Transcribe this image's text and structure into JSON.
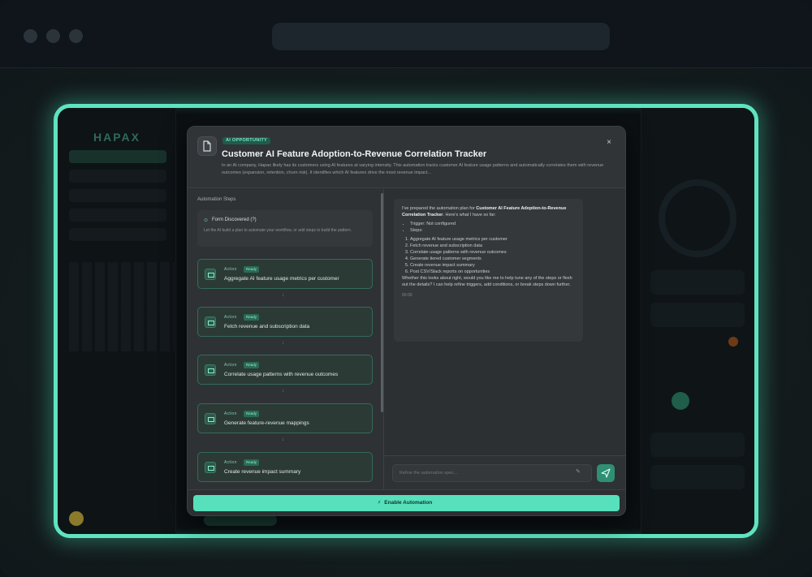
{
  "modal": {
    "badge": "AI Opportunity",
    "title": "Customer AI Feature Adoption-to-Revenue Correlation Tracker",
    "description": "In an AI company, Hapax likely has its customers using AI features at varying intensity. This automation tracks customer AI feature usage patterns and automatically correlates them with revenue outcomes (expansion, retention, churn risk). It identifies which AI features drive the most revenue impact...",
    "close_label": "×"
  },
  "steps": {
    "section_label": "Automation Steps",
    "trigger": {
      "title": "Form Discovered (?)",
      "subtitle": "Let the AI build a plan to automate your workflow, or add steps to build the pattern."
    },
    "items": [
      {
        "kind": "Action",
        "status": "Ready",
        "label": "Aggregate AI feature usage metrics per customer"
      },
      {
        "kind": "Action",
        "status": "Ready",
        "label": "Fetch revenue and subscription data"
      },
      {
        "kind": "Action",
        "status": "Ready",
        "label": "Correlate usage patterns with revenue outcomes"
      },
      {
        "kind": "Action",
        "status": "Ready",
        "label": "Generate feature-revenue mappings"
      },
      {
        "kind": "Action",
        "status": "Ready",
        "label": "Create revenue impact summary"
      }
    ]
  },
  "chat": {
    "intro_pre": "I've prepared the automation plan for ",
    "intro_bold": "Customer AI Feature Adoption-to-Revenue Correlation Tracker",
    "intro_post": ". Here's what I have so far:",
    "bullets": [
      "Trigger: Not configured",
      "Steps:"
    ],
    "numbered": [
      "Aggregate AI feature usage metrics per customer",
      "Fetch revenue and subscription data",
      "Correlate usage patterns with revenue outcomes",
      "Generate tiered customer segments",
      "Create revenue impact summary",
      "Post CSV/Slack reports on opportunities"
    ],
    "closing": "Whether this looks about right, would you like me to help tune any of the steps or flesh out the details? I can help refine triggers, add conditions, or break steps down further.",
    "timestamp": "00:00",
    "input_placeholder": "Refine the automation spec..."
  },
  "footer": {
    "enable_label": "Enable Automation"
  },
  "background": {
    "logo": "HAPAX"
  }
}
